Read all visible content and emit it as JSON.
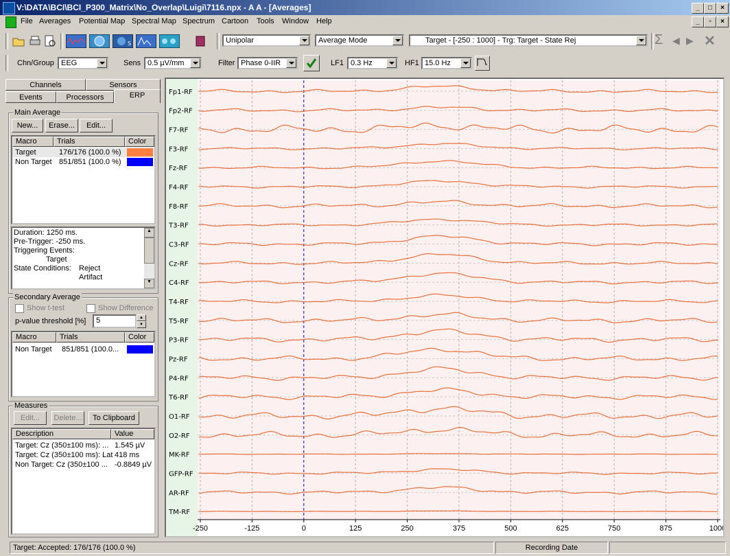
{
  "window": {
    "title": "V:\\DATA\\BCI\\BCI_P300_Matrix\\No_Overlap\\Luigi\\7116.npx - A A - [Averages]"
  },
  "menu": [
    "File",
    "Averages",
    "Potential Map",
    "Spectral Map",
    "Spectrum",
    "Cartoon",
    "Tools",
    "Window",
    "Help"
  ],
  "toolbar": {
    "montage": "Unipolar",
    "mode": "Average Mode",
    "selection": "Target - [-250 : 1000] - Trg: Target - State Rej",
    "chn_group_label": "Chn/Group",
    "chn_group": "EEG",
    "sens_label": "Sens",
    "sens": "0.5 µV/mm",
    "filter_label": "Filter",
    "filter": "Phase 0-IIR",
    "lf1_label": "LF1",
    "lf1": "0.3 Hz",
    "hf1_label": "HF1",
    "hf1": "15.0 Hz"
  },
  "tabs": {
    "channels": "Channels",
    "sensors": "Sensors",
    "events": "Events",
    "processors": "Processors",
    "erp": "ERP"
  },
  "main_average": {
    "label": "Main Average",
    "new": "New...",
    "erase": "Erase...",
    "edit": "Edit...",
    "headers": [
      "Macro",
      "Trials",
      "Color"
    ],
    "rows": [
      {
        "macro": "Target",
        "trials": "176/176  (100.0 %)",
        "color": "#ff7f40"
      },
      {
        "macro": "Non Target",
        "trials": "851/851  (100.0 %)",
        "color": "#0000ff"
      }
    ],
    "info_lines": [
      "Duration: 1250 ms.",
      "Pre-Trigger: -250 ms.",
      "Triggering Events:",
      "Target",
      "State Conditions:",
      "Reject",
      "Artifact"
    ]
  },
  "secondary_average": {
    "label": "Secondary Average",
    "show_ttest": "Show t-test",
    "show_difference": "Show Difference",
    "pvalue_label": "p-value threshold [%]",
    "pvalue": "5",
    "headers": [
      "Macro",
      "Trials",
      "Color"
    ],
    "rows": [
      {
        "macro": "Non Target",
        "trials": "851/851  (100.0...",
        "color": "#0000ff"
      }
    ]
  },
  "measures": {
    "label": "Measures",
    "edit": "Edit...",
    "delete": "Delete...",
    "clipboard": "To Clipboard",
    "headers": [
      "Description",
      "Value"
    ],
    "rows": [
      {
        "desc": "Target: Cz (350±100 ms): ...",
        "value": "1.545 µV"
      },
      {
        "desc": "Target: Cz (350±100 ms): Lat",
        "value": "418 ms"
      },
      {
        "desc": "Non Target: Cz (350±100 ...",
        "value": "-0.8849 µV"
      }
    ]
  },
  "plot": {
    "channels": [
      "Fp1-RF",
      "Fp2-RF",
      "F7-RF",
      "F3-RF",
      "Fz-RF",
      "F4-RF",
      "F8-RF",
      "T3-RF",
      "C3-RF",
      "Cz-RF",
      "C4-RF",
      "T4-RF",
      "T5-RF",
      "P3-RF",
      "Pz-RF",
      "P4-RF",
      "T6-RF",
      "O1-RF",
      "O2-RF",
      "MK-RF",
      "GFP-RF",
      "AR-RF",
      "TM-RF"
    ],
    "time_ticks": [
      "-250",
      "-125",
      "0",
      "125",
      "250",
      "375",
      "500",
      "625",
      "750",
      "875",
      "1000"
    ],
    "xlim": [
      -250,
      1000
    ],
    "trigger_ms": 0,
    "trace_color": "#e8703a",
    "background_color": "#fdf0f0",
    "label_panel_color": "#e6f5e6"
  },
  "status": {
    "left": "Target: Accepted: 176/176  (100.0 %)",
    "middle": "Recording Date"
  }
}
